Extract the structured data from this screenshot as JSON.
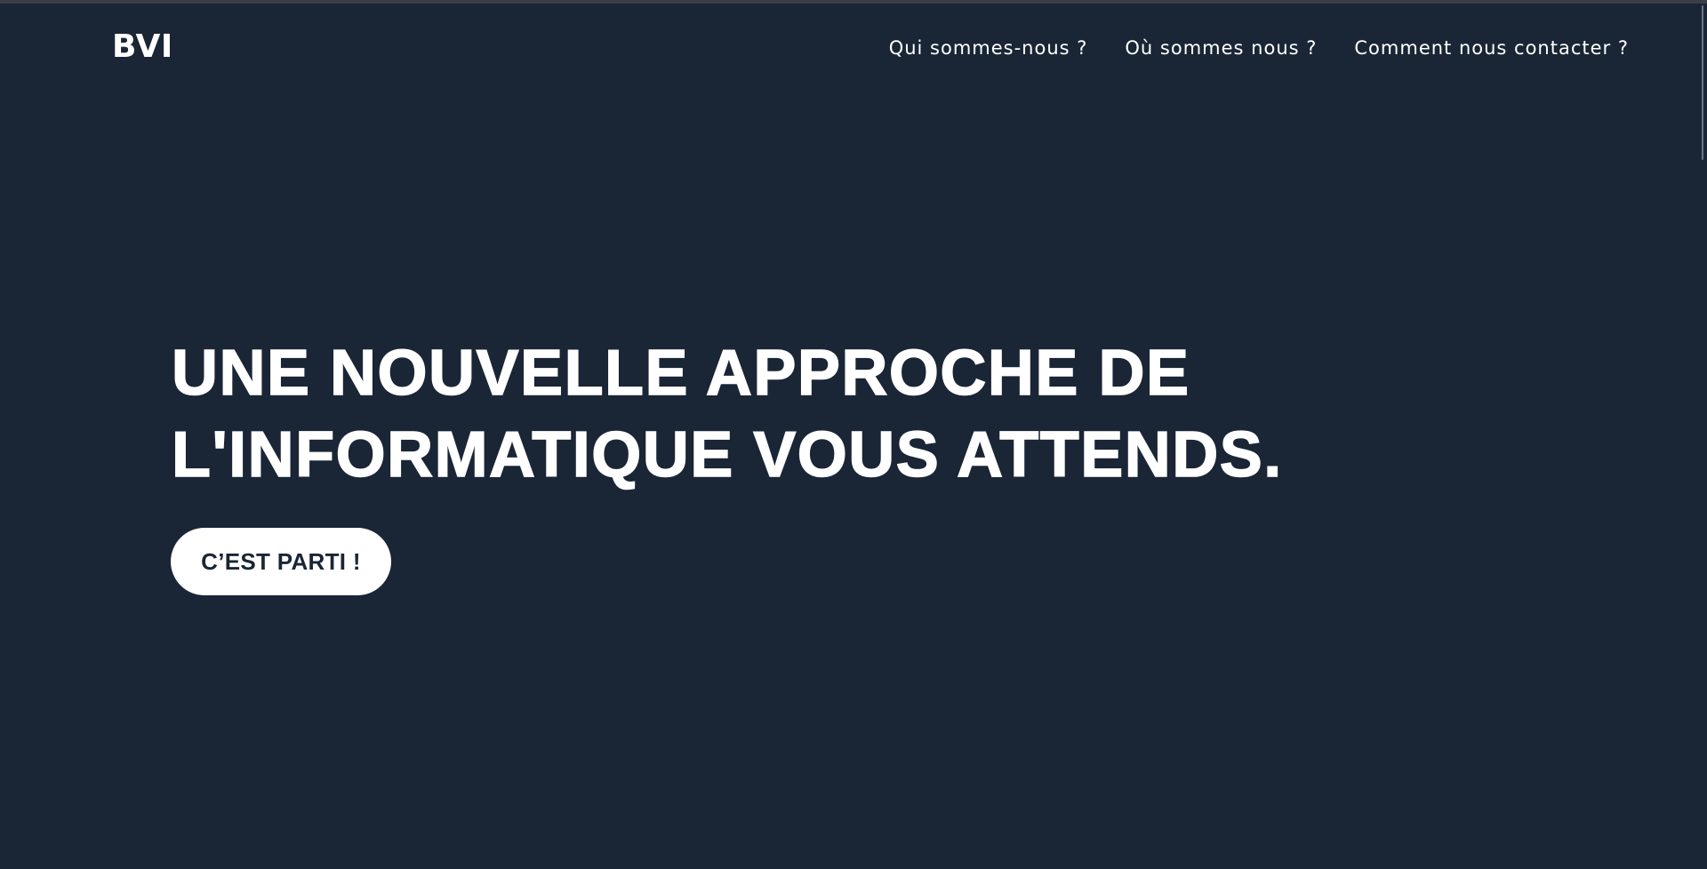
{
  "navbar": {
    "brand": "BVI",
    "links": [
      {
        "label": "Qui sommes-nous ?"
      },
      {
        "label": "Où sommes nous ?"
      },
      {
        "label": "Comment nous contacter ?"
      }
    ]
  },
  "hero": {
    "title_line_1": "UNE NOUVELLE APPROCHE DE",
    "title_line_2": "L'INFORMATIQUE VOUS ATTENDS.",
    "cta_label": "C’EST PARTI !"
  },
  "colors": {
    "background": "#1a2535",
    "text": "#ffffff",
    "button_bg": "#ffffff",
    "button_text": "#1a2535"
  }
}
